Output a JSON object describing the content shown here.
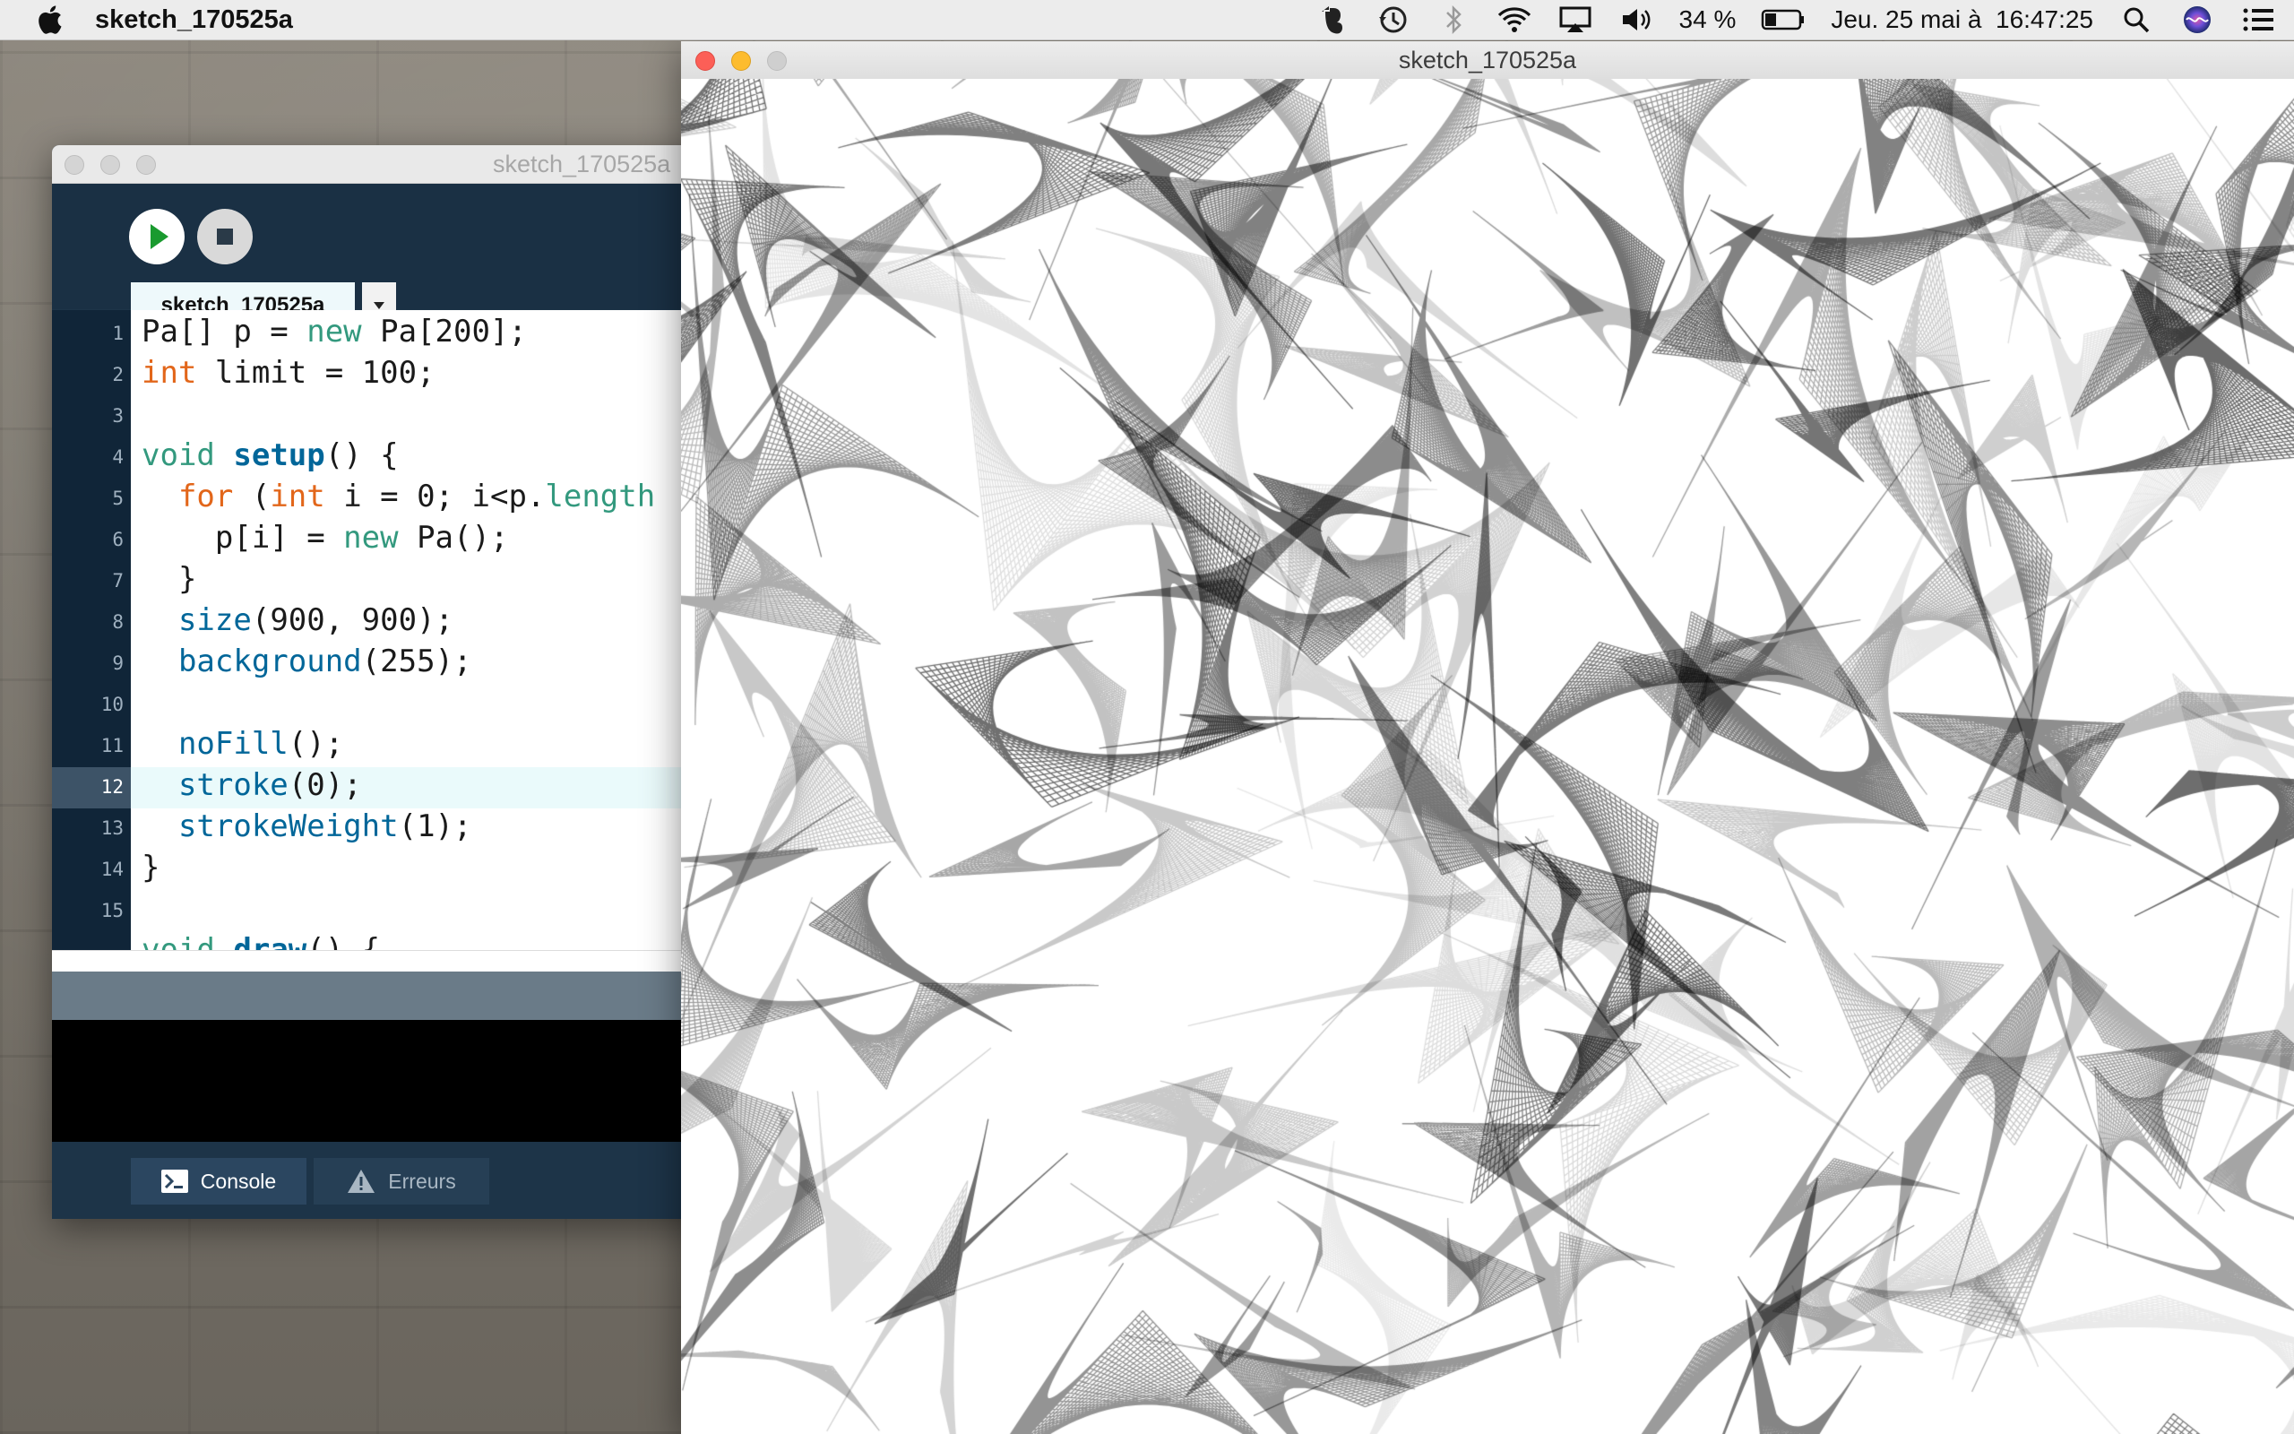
{
  "menubar": {
    "app_name": "sketch_170525a",
    "battery": "34 %",
    "datetime": "Jeu. 25 mai à  16:47:25",
    "icons": [
      "apple-icon",
      "evernote-icon",
      "time-machine-icon",
      "bluetooth-icon",
      "wifi-icon",
      "airplay-icon",
      "volume-icon",
      "battery-icon",
      "spotlight-icon",
      "siri-icon",
      "notification-center-icon"
    ]
  },
  "ide": {
    "title": "sketch_170525a",
    "tab_label": "sketch_170525a",
    "line_numbers": [
      "1",
      "2",
      "3",
      "4",
      "5",
      "6",
      "7",
      "8",
      "9",
      "10",
      "11",
      "12",
      "13",
      "14",
      "15"
    ],
    "code": [
      "Pa[] p = new Pa[200];",
      "int limit = 100;",
      "",
      "void setup() {",
      "  for (int i = 0; i<p.length",
      "    p[i] = new Pa();",
      "  }",
      "  size(900, 900);",
      "  background(255);",
      "",
      "  noFill();",
      "  stroke(0);",
      "  strokeWeight(1);",
      "}",
      "",
      "void draw() {"
    ],
    "highlighted_line": "12",
    "footer": {
      "console_label": "Console",
      "errors_label": "Erreurs"
    }
  },
  "sketch_window": {
    "title": "sketch_170525a",
    "background": "#ffffff",
    "stroke": "#000000"
  },
  "colors": {
    "ide_dark": "#1d3448",
    "keyword_orange": "#e2661a",
    "keyword_green": "#33997e",
    "keyword_blue": "#006699"
  }
}
